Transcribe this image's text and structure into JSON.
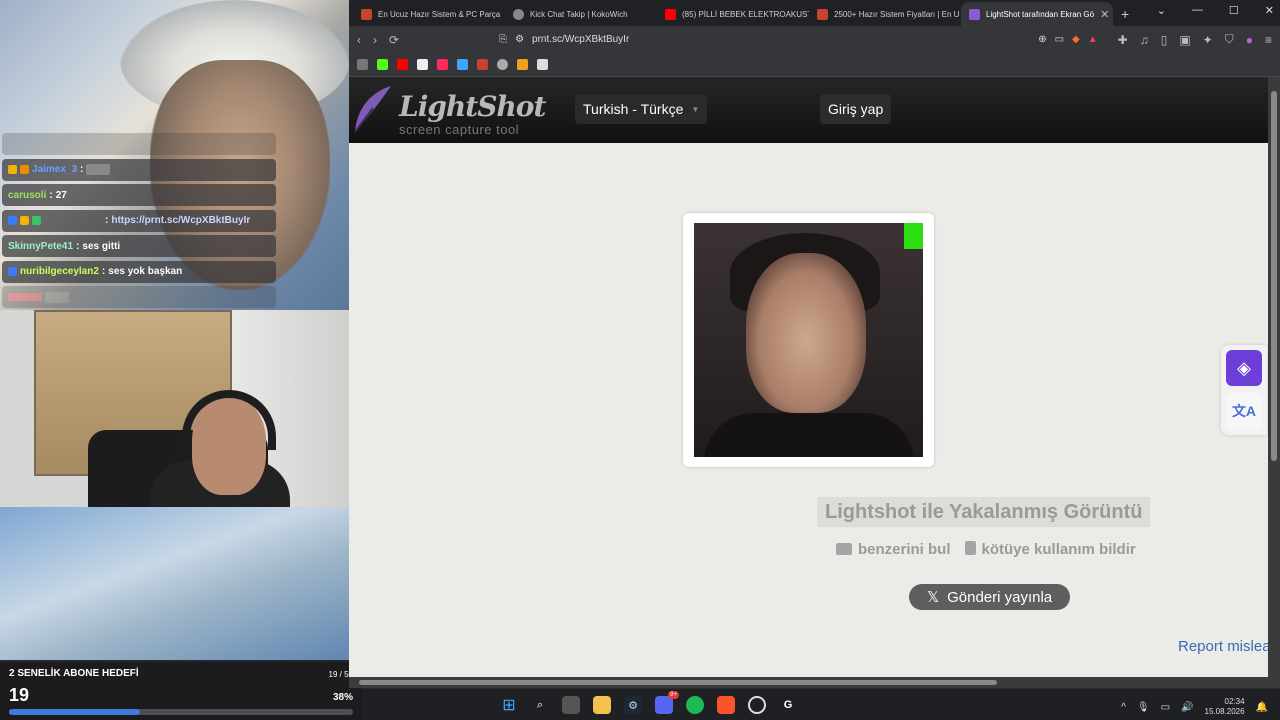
{
  "stream": {
    "chat": [
      {
        "user": "",
        "text": ""
      },
      {
        "user": "Jaimex_3",
        "text": ""
      },
      {
        "user": "carusoli",
        "text": "27"
      },
      {
        "user": "",
        "text": "https://prnt.sc/WcpXBktBuyIr"
      },
      {
        "user": "SkinnyPete41",
        "text": "ses gitti"
      },
      {
        "user": "nuribilgeceylan2",
        "text": "ses yok başkan"
      },
      {
        "user": "",
        "text": ""
      }
    ],
    "goal": {
      "title": "2 SENELİK ABONE HEDEFİ",
      "count": "19 / 50",
      "value": "19",
      "percent_text": "38%",
      "percent": 38
    }
  },
  "browser": {
    "tabs": [
      {
        "title": "En Ucuz Hazır Sistem & PC Parça",
        "color": "#c7432f",
        "active": false
      },
      {
        "title": "Kick Chat Takip | KokoWich",
        "color": "#888888",
        "active": false
      },
      {
        "title": "(85) PİLLİ BEBEK ELEKTROAKUST",
        "color": "#ff0000",
        "active": false
      },
      {
        "title": "2500+ Hazır Sistem Fiyatları | En U",
        "color": "#c7432f",
        "active": false
      },
      {
        "title": "LightShot tarafından Ekran Gö",
        "color": "#8c5ad8",
        "active": true
      }
    ],
    "new_tab": "+",
    "url": "prnt.sc/WcpXBktBuyIr"
  },
  "lightshot": {
    "logo": "LightShot",
    "logo_sub": "screen capture tool",
    "language": "Turkish - Türkçe",
    "login": "Giriş yap",
    "caption": "Lightshot ile Yakalanmış Görüntü",
    "find_similar": "benzerini bul",
    "report_abuse": "kötüye kullanım bildir",
    "post": "Gönderi yayınla",
    "report_link": "Report mislea"
  },
  "taskbar": {
    "time": "02:34",
    "date": "15.08.2026",
    "discord_badge": "9+"
  }
}
